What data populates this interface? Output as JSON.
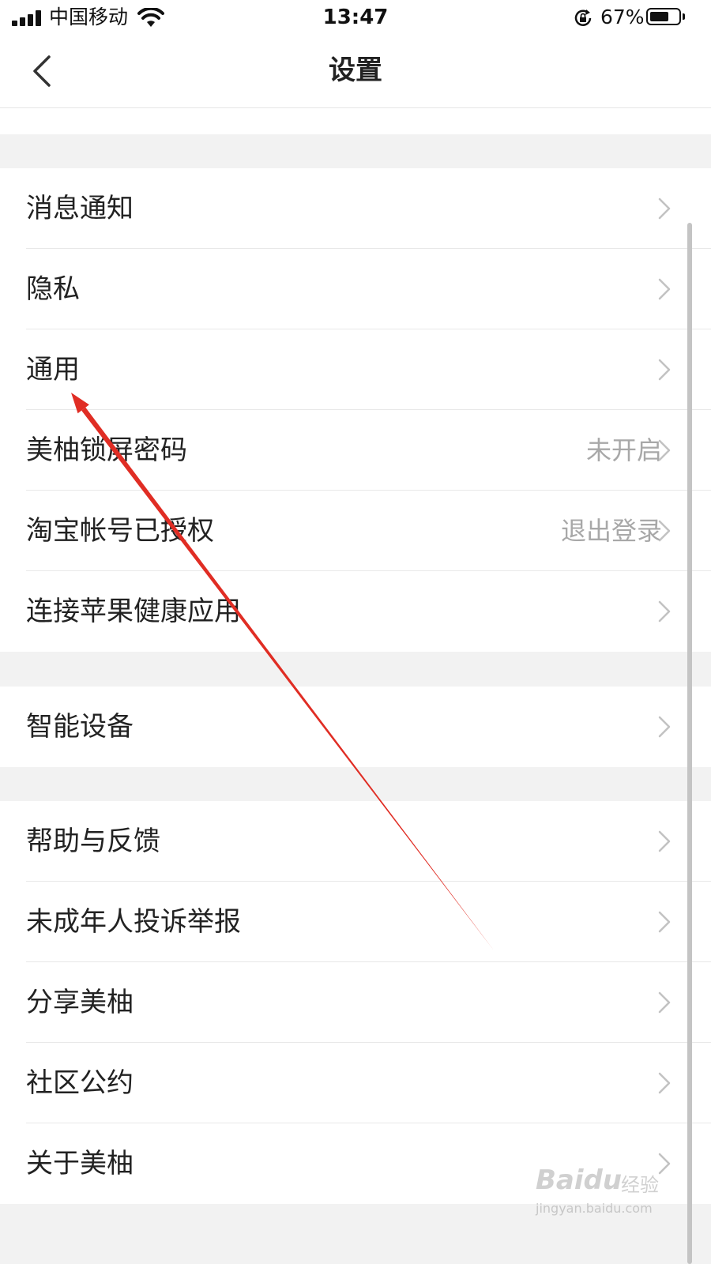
{
  "status_bar": {
    "carrier": "中国移动",
    "time": "13:47",
    "battery_percent": "67%",
    "battery_level": 0.67,
    "icons": [
      "signal-icon",
      "wifi-icon",
      "rotation-lock-icon",
      "battery-icon"
    ]
  },
  "nav": {
    "title": "设置",
    "back_icon": "chevron-left-icon"
  },
  "groups": [
    {
      "items": [
        {
          "label": "消息通知",
          "value": ""
        },
        {
          "label": "隐私",
          "value": ""
        },
        {
          "label": "通用",
          "value": ""
        },
        {
          "label": "美柚锁屏密码",
          "value": "未开启"
        },
        {
          "label": "淘宝帐号已授权",
          "value": "退出登录"
        },
        {
          "label": "连接苹果健康应用",
          "value": ""
        }
      ]
    },
    {
      "items": [
        {
          "label": "智能设备",
          "value": ""
        }
      ]
    },
    {
      "items": [
        {
          "label": "帮助与反馈",
          "value": ""
        },
        {
          "label": "未成年人投诉举报",
          "value": ""
        },
        {
          "label": "分享美柚",
          "value": ""
        },
        {
          "label": "社区公约",
          "value": ""
        },
        {
          "label": "关于美柚",
          "value": ""
        }
      ]
    }
  ],
  "annotation": {
    "color": "#e02d24",
    "points_to": "通用"
  },
  "watermark": {
    "logo": "Baidu",
    "cn": "经验",
    "url": "jingyan.baidu.com"
  },
  "colors": {
    "background": "#f2f2f2",
    "row_bg": "#ffffff",
    "value_text": "#a8a8a8",
    "chevron": "#c2c2c2"
  }
}
